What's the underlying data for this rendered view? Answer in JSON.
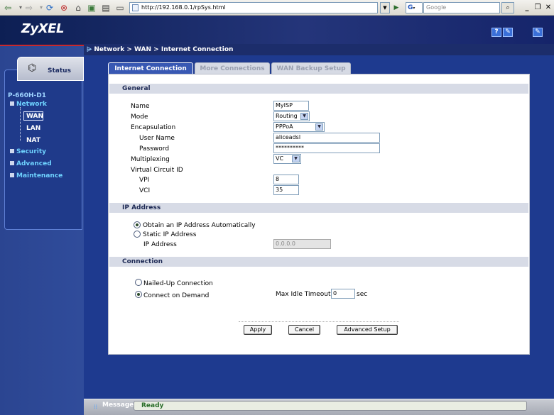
{
  "browser": {
    "url": "http://192.168.0.1/rpSys.html",
    "search_engine_icon": "G",
    "search_placeholder": "Google"
  },
  "header": {
    "logo": "ZyXEL",
    "help_icon_label": "?",
    "icon2_label": "✎",
    "logout_icon_label": "✎"
  },
  "breadcrumb": "Network > WAN > Internet Connection",
  "sidebar": {
    "status_label": "Status",
    "device_name": "P-660H-D1",
    "network_label": "Network",
    "network_items": [
      "WAN",
      "LAN",
      "NAT"
    ],
    "security_label": "Security",
    "advanced_label": "Advanced",
    "maintenance_label": "Maintenance"
  },
  "tabs": [
    "Internet Connection",
    "More Connections",
    "WAN Backup Setup"
  ],
  "general": {
    "title": "General",
    "name_label": "Name",
    "name_value": "MyISP",
    "mode_label": "Mode",
    "mode_value": "Routing",
    "encapsulation_label": "Encapsulation",
    "encapsulation_value": "PPPoA",
    "username_label": "User Name",
    "username_value": "aliceadsl",
    "password_label": "Password",
    "password_value": "**********",
    "multiplexing_label": "Multiplexing",
    "multiplexing_value": "VC",
    "vc_label": "Virtual Circuit ID",
    "vpi_label": "VPI",
    "vpi_value": "8",
    "vci_label": "VCI",
    "vci_value": "35"
  },
  "ip_address": {
    "title": "IP Address",
    "auto_label": "Obtain an IP Address Automatically",
    "static_label": "Static IP Address",
    "ip_label": "IP Address",
    "ip_value": "0.0.0.0"
  },
  "connection": {
    "title": "Connection",
    "nailed_label": "Nailed-Up Connection",
    "demand_label": "Connect on Demand",
    "max_idle_label": "Max Idle Timeout",
    "max_idle_value": "0",
    "sec_label": "sec"
  },
  "buttons": {
    "apply": "Apply",
    "cancel": "Cancel",
    "advanced": "Advanced Setup"
  },
  "statusbar": {
    "caption": "Message",
    "message": "Ready"
  }
}
